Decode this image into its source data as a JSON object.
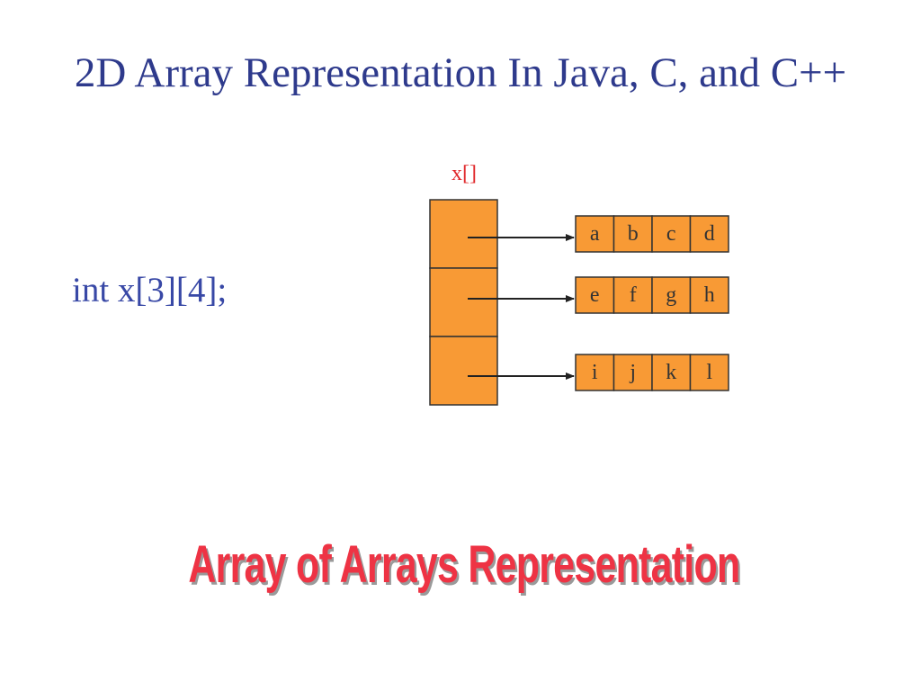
{
  "slide": {
    "title": "2D Array Representation In Java, C, and C++",
    "declaration": "int x[3][4];",
    "banner": "Array of Arrays Representation"
  },
  "diagram": {
    "pointer_array_label": "x[]",
    "rows": [
      [
        "a",
        "b",
        "c",
        "d"
      ],
      [
        "e",
        "f",
        "g",
        "h"
      ],
      [
        "i",
        "j",
        "k",
        "l"
      ]
    ]
  },
  "colors": {
    "title": "#2e3a8c",
    "declaration": "#3848a6",
    "pointer_label": "#e0282b",
    "cell_fill": "#f89a35",
    "cell_border": "#333333",
    "arrow": "#222222",
    "banner": "#ee3344"
  }
}
